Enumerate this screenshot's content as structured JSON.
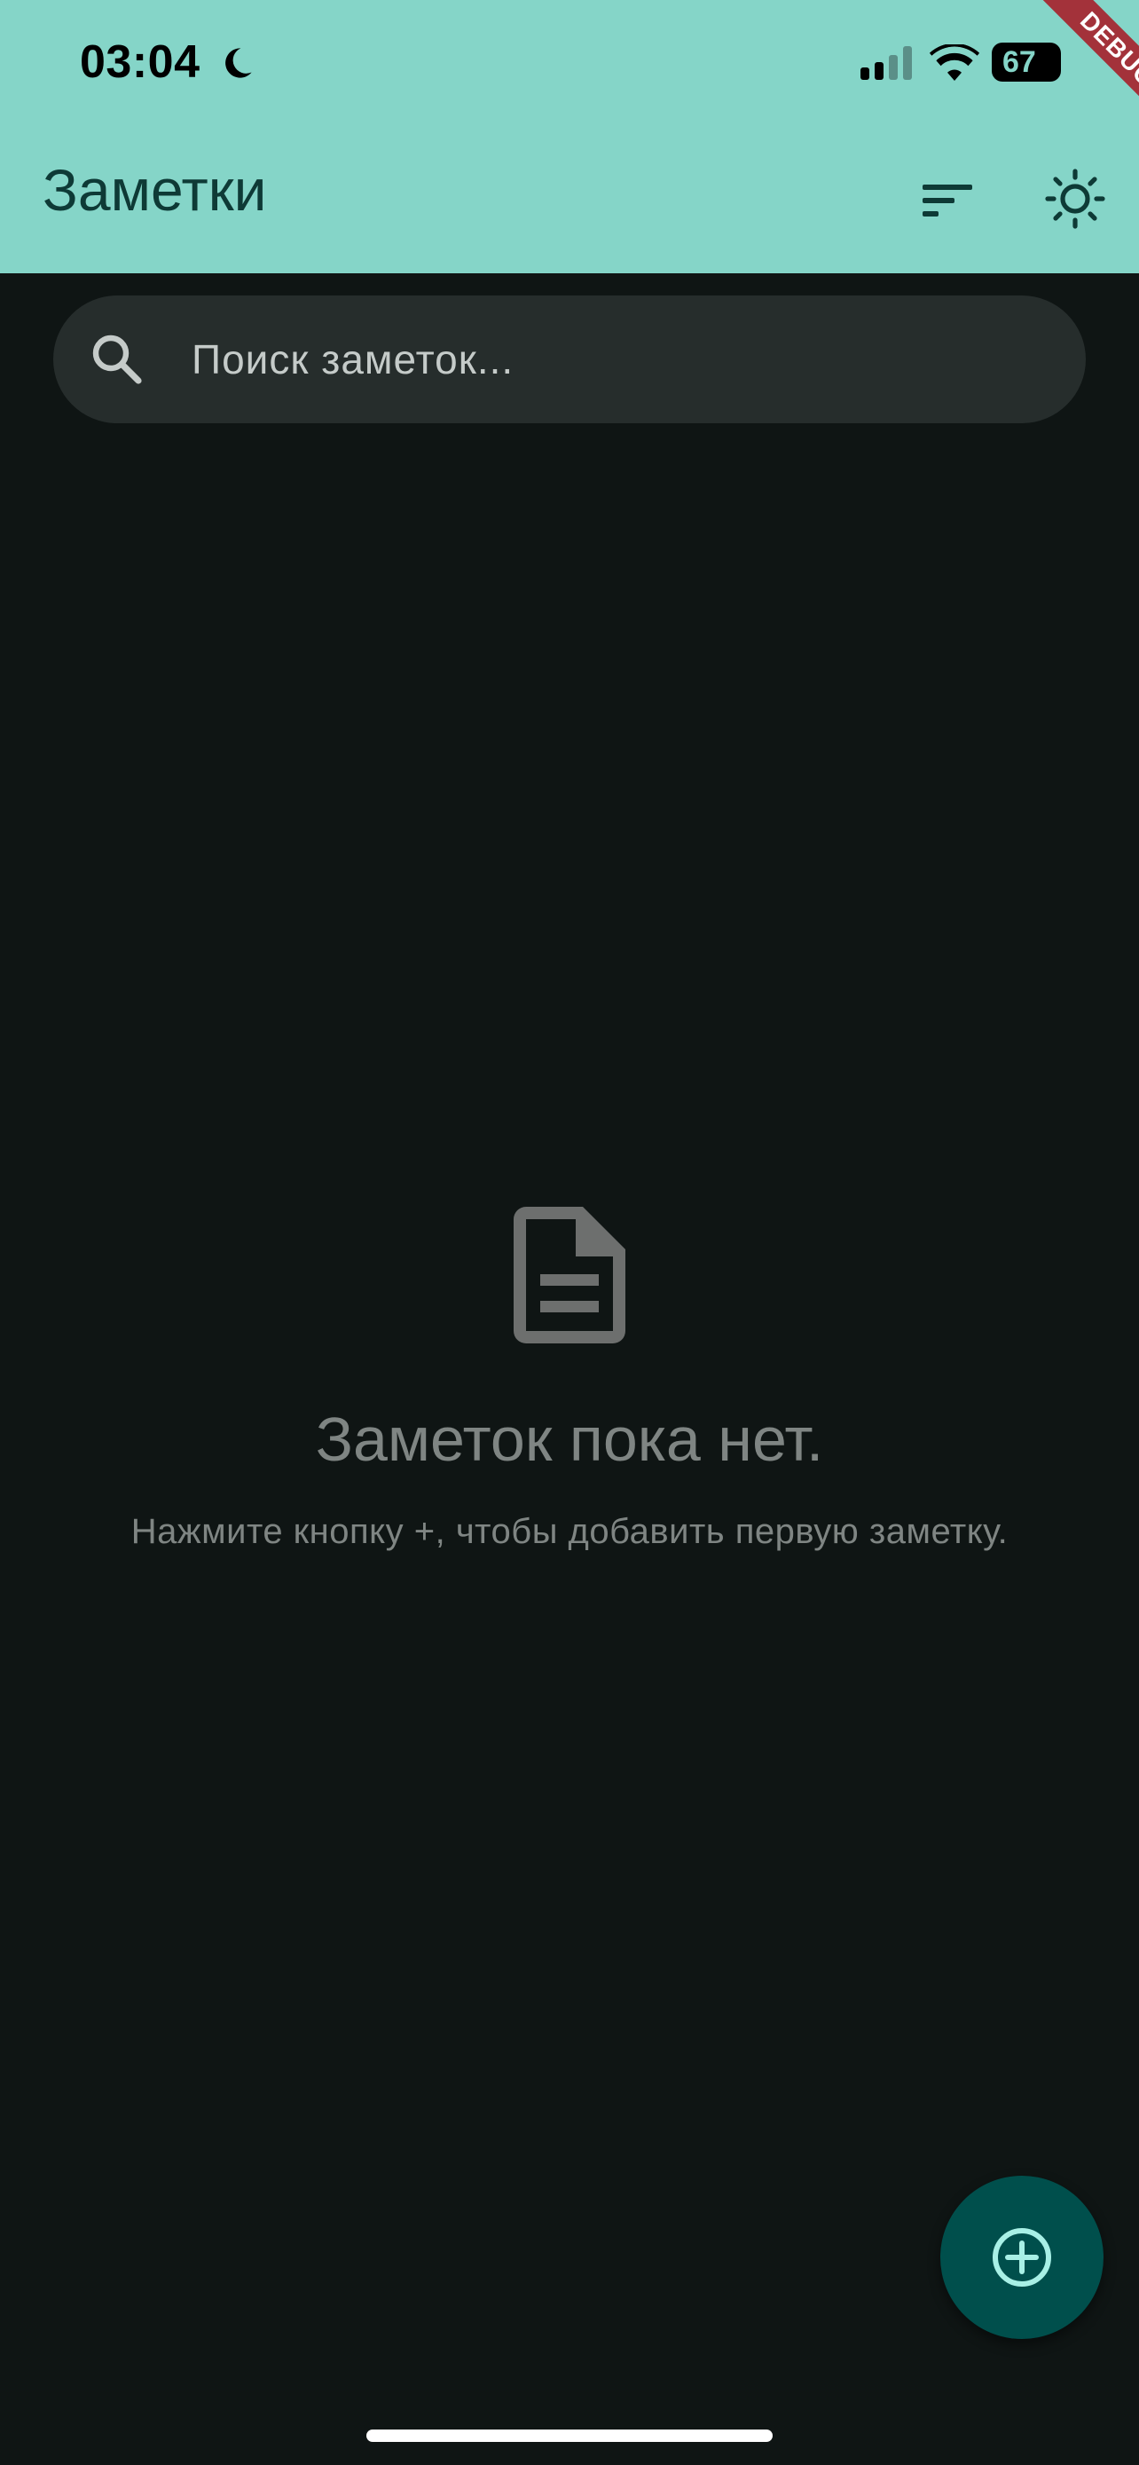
{
  "status_bar": {
    "time": "03:04",
    "battery": "67",
    "icons": [
      "moon-icon",
      "cellular-signal-icon",
      "wifi-icon",
      "battery-icon"
    ]
  },
  "debug_banner": "DEBUG",
  "app_bar": {
    "title": "Заметки",
    "actions": [
      "sort-icon",
      "light-mode-icon"
    ]
  },
  "search": {
    "placeholder": "Поиск заметок...",
    "value": "",
    "icon": "search-icon"
  },
  "empty_state": {
    "icon": "document-icon",
    "title": "Заметок пока нет.",
    "subtitle": "Нажмите кнопку +, чтобы добавить первую заметку."
  },
  "fab": {
    "icon": "add-circle-icon"
  },
  "colors": {
    "app_bar": "#85d5c8",
    "background": "#0f1514",
    "search_field": "#262d2c",
    "fab": "#004f4c",
    "fab_icon": "#a8f0e6",
    "muted_text": "#7f8583",
    "title_text": "#0e3a36",
    "debug_ribbon": "#a3323a"
  }
}
